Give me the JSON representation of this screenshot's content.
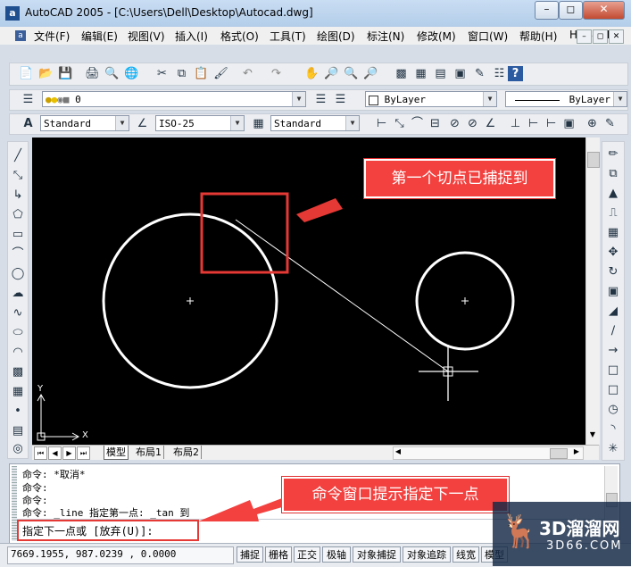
{
  "window": {
    "app_icon_text": "a",
    "title": "AutoCAD 2005 - [C:\\Users\\Dell\\Desktop\\Autocad.dwg]",
    "btn_minimize": "–",
    "btn_restore": "◻",
    "btn_close": "✕"
  },
  "menu": {
    "items": [
      "文件(F)",
      "编辑(E)",
      "视图(V)",
      "插入(I)",
      "格式(O)",
      "工具(T)",
      "绘图(D)",
      "标注(N)",
      "修改(M)",
      "窗口(W)",
      "帮助(H)",
      "HDSHM"
    ],
    "mdi_min": "–",
    "mdi_restore": "◻",
    "mdi_close": "✕"
  },
  "layer_toolbar": {
    "layer_value": "0",
    "color_value": "ByLayer",
    "linetype_value": "ByLayer"
  },
  "styles_toolbar": {
    "text_style": "Standard",
    "dim_style": "ISO-25",
    "table_style": "Standard"
  },
  "canvas": {
    "background": "#000000",
    "ucs_y": "Y",
    "ucs_x": "X"
  },
  "layout_tabs": {
    "model": "模型",
    "layout1": "布局1",
    "layout2": "布局2"
  },
  "command_window": {
    "lines": [
      "命令: *取消*",
      "命令:",
      "命令:",
      "命令: _line 指定第一点: _tan 到"
    ],
    "prompt": "指定下一点或 [放弃(U)]:"
  },
  "status_bar": {
    "coords": "7669.1955, 987.0239 , 0.0000",
    "buttons": [
      "捕捉",
      "栅格",
      "正交",
      "极轴",
      "对象捕捉",
      "对象追踪",
      "线宽",
      "模型"
    ]
  },
  "annotations": {
    "tangent_captured": "第一个切点已捕捉到",
    "command_hint": "命令窗口提示指定下一点",
    "accent": "#f2413f"
  },
  "watermark": {
    "brand": "3D溜溜网",
    "url": "3D66.COM"
  }
}
